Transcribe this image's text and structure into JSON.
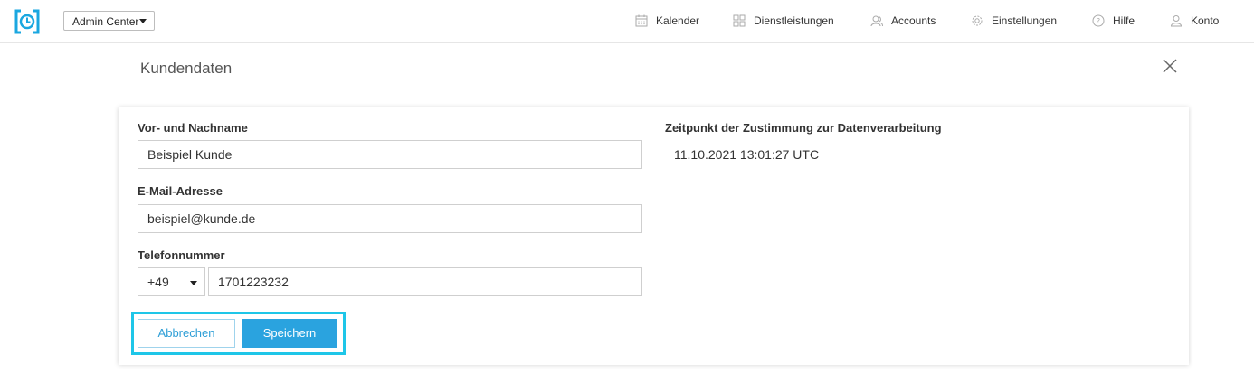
{
  "header": {
    "app_selector": "Admin Center",
    "nav": [
      {
        "label": "Kalender",
        "icon": "calendar-icon"
      },
      {
        "label": "Dienstleistungen",
        "icon": "grid-icon"
      },
      {
        "label": "Accounts",
        "icon": "users-icon"
      },
      {
        "label": "Einstellungen",
        "icon": "gear-icon"
      },
      {
        "label": "Hilfe",
        "icon": "help-icon"
      },
      {
        "label": "Konto",
        "icon": "user-icon"
      }
    ]
  },
  "page": {
    "title": "Kundendaten"
  },
  "form": {
    "name_label": "Vor- und Nachname",
    "name_value": "Beispiel Kunde",
    "email_label": "E-Mail-Adresse",
    "email_value": "beispiel@kunde.de",
    "phone_label": "Telefonnummer",
    "phone_country_code": "+49",
    "phone_value": "1701223232",
    "consent_label": "Zeitpunkt der Zustimmung zur Datenverarbeitung",
    "consent_value": "11.10.2021 13:01:27 UTC",
    "cancel_label": "Abbrechen",
    "save_label": "Speichern"
  },
  "colors": {
    "accent": "#2aa3df",
    "highlight": "#1ec6e8",
    "logo": "#1aa7e0"
  }
}
